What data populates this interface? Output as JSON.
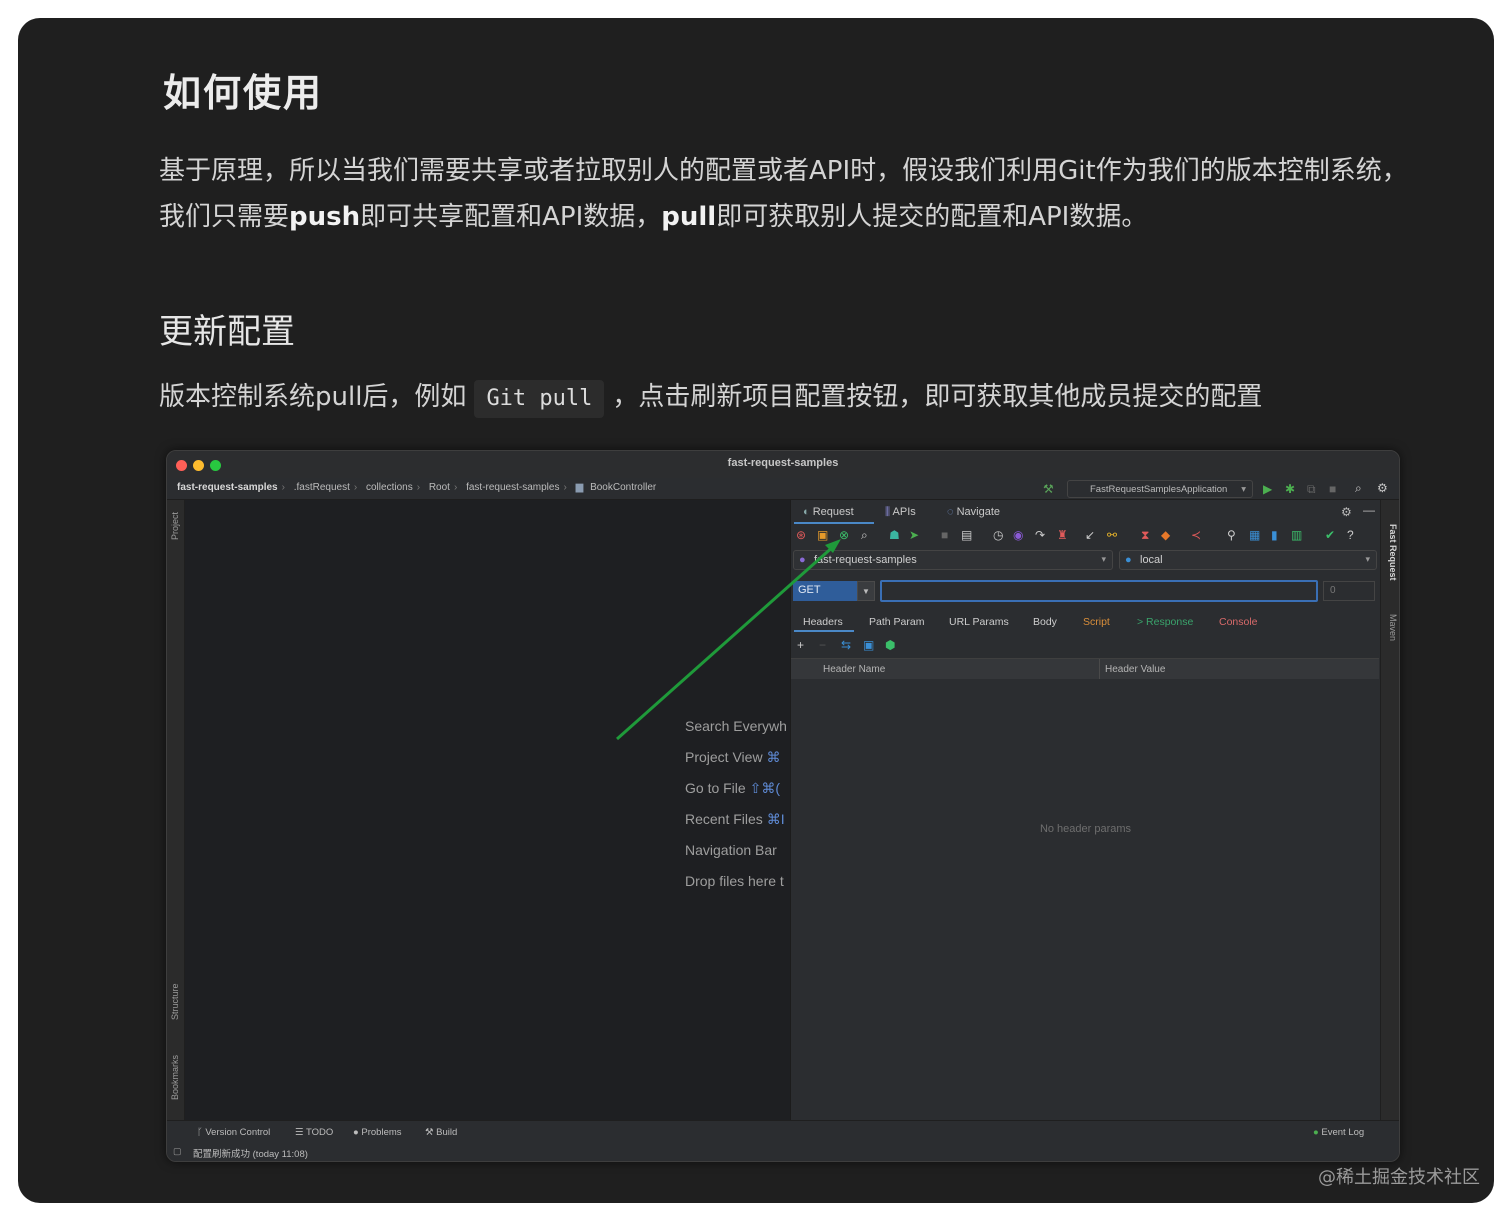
{
  "article": {
    "heading": "如何使用",
    "paragraph_parts": [
      "基于原理，所以当我们需要共享或者拉取别人的配置或者API时，假设我们利用Git作为我们的版本控制系统，我们只需要",
      "push",
      "即可共享配置和API数据，",
      "pull",
      "即可获取别人提交的配置和API数据。"
    ],
    "subheading": "更新配置",
    "para2_pre": "版本控制系统pull后，例如",
    "para2_code": "Git pull",
    "para2_post": "，点击刷新项目配置按钮，即可获取其他成员提交的配置",
    "watermark": "@稀土掘金技术社区"
  },
  "ide": {
    "title": "fast-request-samples",
    "breadcrumbs": [
      "fast-request-samples",
      ".fastRequest",
      "collections",
      "Root",
      "fast-request-samples",
      "BookController"
    ],
    "run_config": "FastRequestSamplesApplication",
    "left_strip": [
      "Project",
      "Structure",
      "Bookmarks"
    ],
    "right_strip": [
      "Fast Request",
      "Maven"
    ],
    "welcome": [
      {
        "label": "Search Everywh",
        "key": ""
      },
      {
        "label": "Project View",
        "key": "⌘"
      },
      {
        "label": "Go to File",
        "key": "⇧⌘("
      },
      {
        "label": "Recent Files",
        "key": "⌘I"
      },
      {
        "label": "Navigation Bar",
        "key": ""
      },
      {
        "label": "Drop files here t",
        "key": ""
      }
    ],
    "panel": {
      "tabs": [
        "Request",
        "APIs",
        "Navigate"
      ],
      "project_select": "fast-request-samples",
      "env_select": "local",
      "method": "GET",
      "port": "0",
      "subtabs": [
        "Headers",
        "Path Param",
        "URL Params",
        "Body",
        "Script",
        "> Response",
        "Console"
      ],
      "header_name": "Header Name",
      "header_value": "Header Value",
      "empty_text": "No header params"
    },
    "status": {
      "items": [
        "Version Control",
        "TODO",
        "Problems",
        "Build"
      ],
      "event_log": "Event Log",
      "message": "配置刷新成功 (today 11:08)"
    },
    "colors": {
      "accent": "#4a88c7",
      "arrow": "#1f9a3a",
      "script_tab": "#d98e3a",
      "response_tab": "#3aa36b",
      "console_tab": "#d86a6a"
    }
  }
}
